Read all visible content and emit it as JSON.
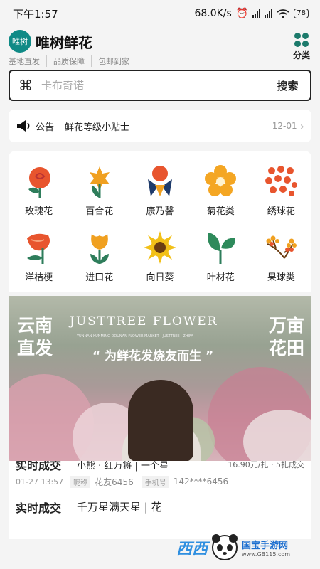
{
  "status": {
    "time": "下午1:57",
    "speed": "68.0K/s",
    "battery": "78"
  },
  "header": {
    "brand": "唯树鲜花",
    "logo_text": "唯树",
    "tags": [
      "基地直发",
      "品质保障",
      "包邮到家"
    ],
    "category_label": "分类"
  },
  "search": {
    "placeholder": "卡布奇诺",
    "button": "搜索"
  },
  "notice": {
    "label": "公告",
    "text": "鲜花等级小贴士",
    "date": "12-01"
  },
  "categories": [
    {
      "label": "玫瑰花",
      "icon": "rose-icon"
    },
    {
      "label": "百合花",
      "icon": "lily-icon"
    },
    {
      "label": "康乃馨",
      "icon": "carnation-icon"
    },
    {
      "label": "菊花类",
      "icon": "chrysanthemum-icon"
    },
    {
      "label": "绣球花",
      "icon": "hydrangea-icon"
    },
    {
      "label": "洋桔梗",
      "icon": "lisianthus-icon"
    },
    {
      "label": "进口花",
      "icon": "tulip-icon"
    },
    {
      "label": "向日葵",
      "icon": "sunflower-icon"
    },
    {
      "label": "叶材花",
      "icon": "leaf-icon"
    },
    {
      "label": "果球类",
      "icon": "berry-icon"
    }
  ],
  "banner": {
    "left": "云南直发",
    "right": "万亩花田",
    "en": "JUSTTREE FLOWER",
    "tiny": "YUNNAN KUNMING DOUNAN FLOWER MARKET · JUSTTREE · ZHIFA",
    "slogan": "“ 为鲜花发烧友而生 ”"
  },
  "deals": [
    {
      "title": "实时成交",
      "product": "小熊 · 红万将 | 一个星",
      "price": "16.90元/扎 · 5扎成交",
      "time": "01-27 13:57",
      "nick_label": "昵称",
      "nick": "花友6456",
      "phone_label": "手机号",
      "phone": "142****6456"
    },
    {
      "title": "实时成交",
      "product": "千万星满天星 | 花",
      "price": "",
      "time": "",
      "nick_label": "",
      "nick": "",
      "phone_label": "",
      "phone": ""
    }
  ],
  "watermark": {
    "brand": "西西",
    "site_top": "国宝手游网",
    "site_url": "www.GB115.com"
  },
  "colors": {
    "brand_teal": "#0f8a86",
    "icon_green": "#1c7a6b"
  }
}
